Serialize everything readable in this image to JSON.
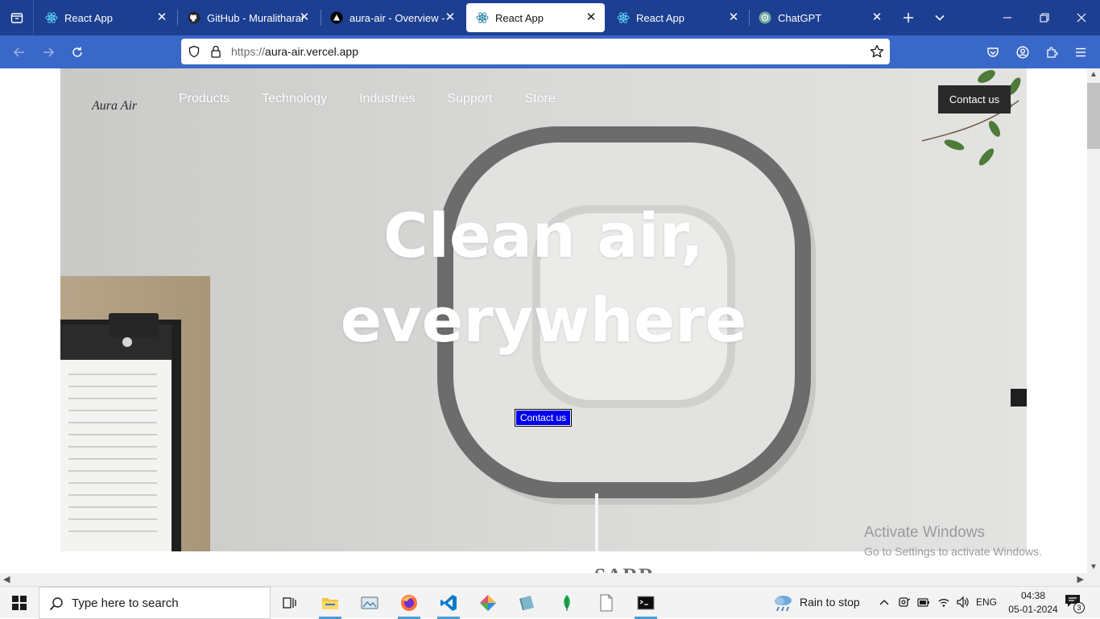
{
  "browser": {
    "tabs": [
      {
        "title": "React App",
        "icon": "react-icon",
        "active": false
      },
      {
        "title": "GitHub - Muralitharan",
        "icon": "github-icon",
        "active": false
      },
      {
        "title": "aura-air - Overview - V",
        "icon": "vercel-icon",
        "active": false
      },
      {
        "title": "React App",
        "icon": "react-icon",
        "active": true
      },
      {
        "title": "React App",
        "icon": "react-icon",
        "active": false
      },
      {
        "title": "ChatGPT",
        "icon": "chatgpt-icon",
        "active": false
      }
    ],
    "url": {
      "scheme": "https://",
      "host": "aura-air.vercel.app"
    }
  },
  "page": {
    "brand": "Aura Air",
    "nav": [
      "Products",
      "Technology",
      "Industries",
      "Support",
      "Store"
    ],
    "top_contact_label": "Contact us",
    "headline_line1": "Clean air,",
    "headline_line2": "everywhere",
    "hero_contact_label": "Contact us",
    "below_text": "SARR",
    "watermark_line1": "Activate Windows",
    "watermark_line2": "Go to Settings to activate Windows."
  },
  "taskbar": {
    "search_placeholder": "Type here to search",
    "weather": "Rain to stop",
    "language": "ENG",
    "time": "04:38",
    "date": "05-01-2024",
    "notification_count": "3"
  },
  "colors": {
    "tabbar": "#1c3f92",
    "toolbar": "#3a68c9",
    "hero_button": "#0000ee",
    "top_button": "#2a2a2a"
  }
}
